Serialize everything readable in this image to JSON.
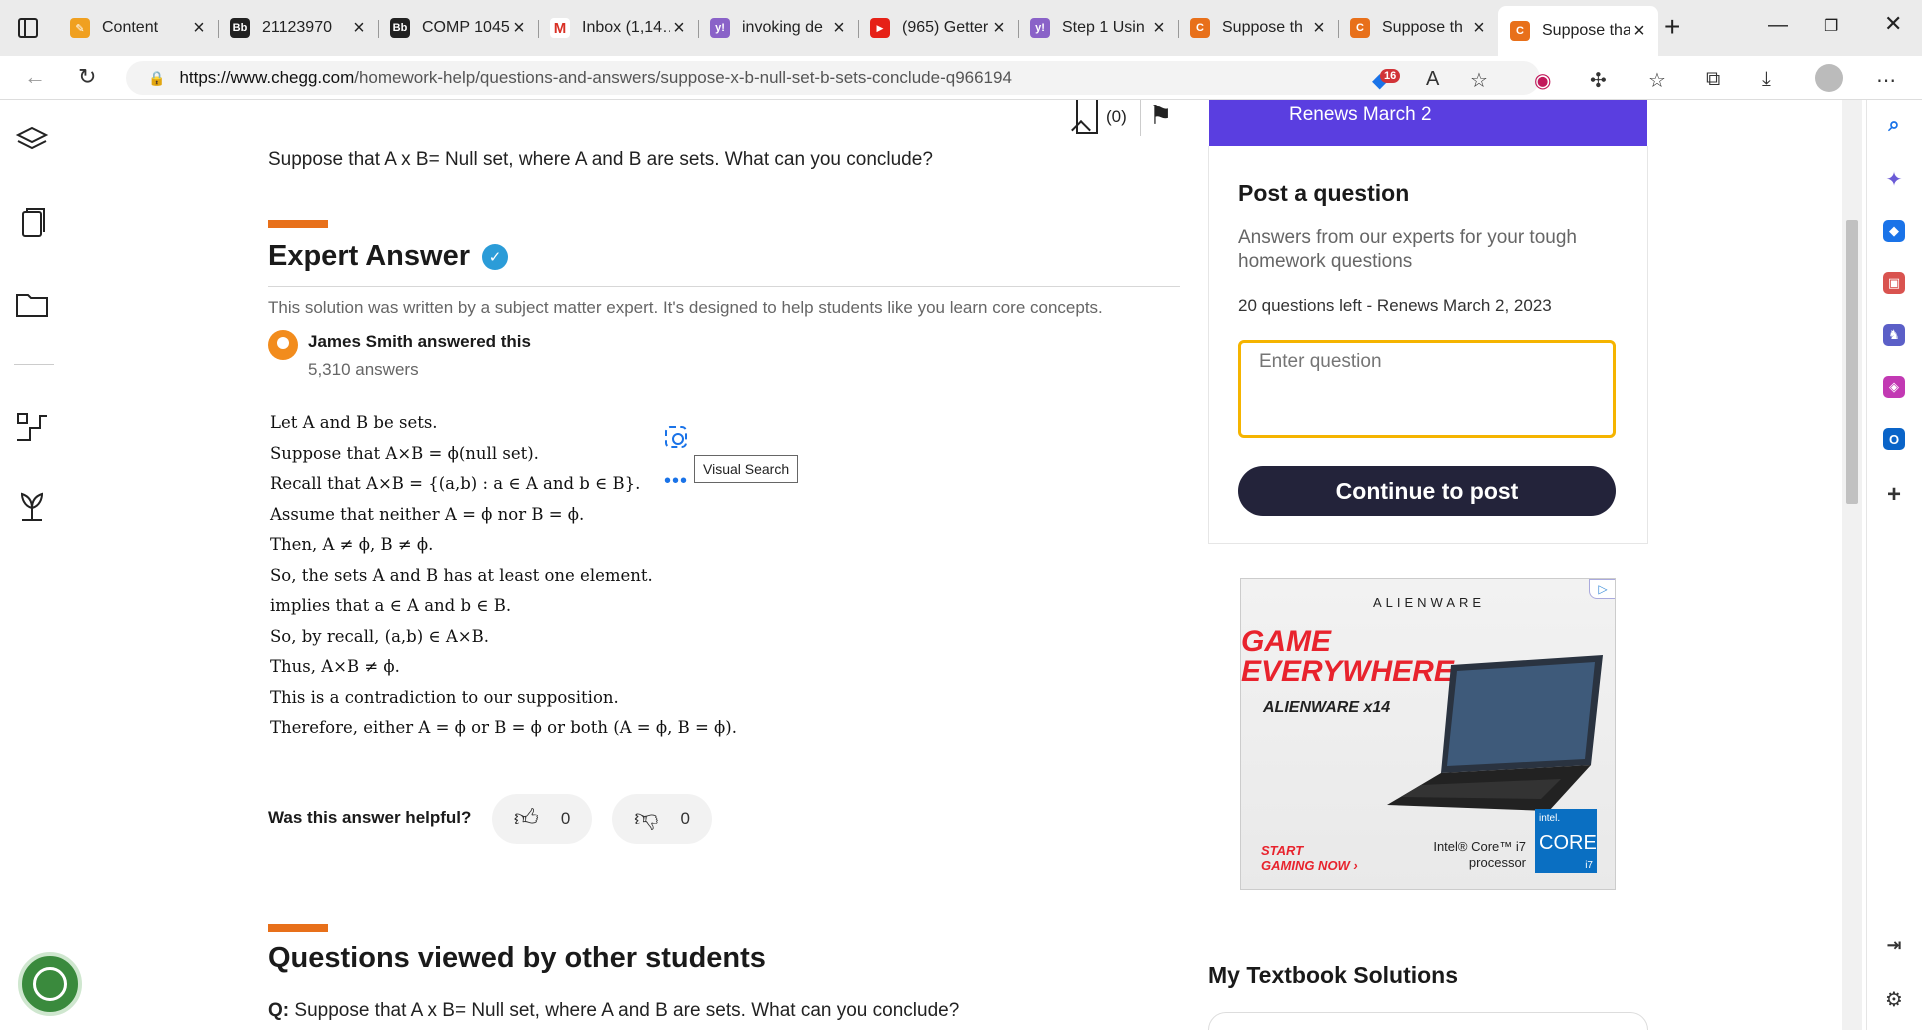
{
  "browser": {
    "tabs": [
      {
        "title": "Content",
        "fav_color": "#f0a020",
        "fav_text": "✎"
      },
      {
        "title": "21123970",
        "fav_color": "#222222",
        "fav_text": "Bb"
      },
      {
        "title": "COMP 1045",
        "fav_color": "#222222",
        "fav_text": "Bb"
      },
      {
        "title": "Inbox (1,14…",
        "fav_color": "#ffffff",
        "fav_text": "M"
      },
      {
        "title": "invoking de",
        "fav_color": "#8a62c8",
        "fav_text": "y!"
      },
      {
        "title": "(965) Getter",
        "fav_color": "#e62117",
        "fav_text": "▶"
      },
      {
        "title": "Step 1 Usin",
        "fav_color": "#8a62c8",
        "fav_text": "y!"
      },
      {
        "title": "Suppose th",
        "fav_color": "#e8701a",
        "fav_text": "C"
      },
      {
        "title": "Suppose th",
        "fav_color": "#e8701a",
        "fav_text": "C"
      },
      {
        "title": "Suppose tha",
        "fav_color": "#e8701a",
        "fav_text": "C"
      }
    ],
    "url_host": "https://www.chegg.com",
    "url_path": "/homework-help/questions-and-answers/suppose-x-b-null-set-b-sets-conclude-q966194",
    "ext_badge": "16"
  },
  "question": {
    "text": "Suppose that A x B= Null set, where A and B are sets. What can you conclude?",
    "bookmark_count": "(0)"
  },
  "expert": {
    "heading": "Expert Answer",
    "note": "This solution was written by a subject matter expert. It's designed to help students like you learn core concepts.",
    "answerer": "James Smith answered this",
    "answers": "5,310 answers"
  },
  "solution_lines": [
    "Let A and B be sets.",
    "Suppose that A×B = ϕ(null set).",
    "Recall that A×B = {(a,b) : a ∈ A and b ∈ B}.",
    "Assume that neither A = ϕ nor B = ϕ.",
    "Then, A ≠ ϕ, B ≠ ϕ.",
    "So, the sets A and B has at least one element.",
    "implies that a ∈ A and b ∈ B.",
    "So, by recall, (a,b) ∈ A×B.",
    "Thus, A×B ≠ ϕ.",
    "This is a contradiction to our supposition.",
    "Therefore, either A = ϕ or B = ϕ or both (A = ϕ, B = ϕ)."
  ],
  "visual_search": {
    "tooltip": "Visual Search"
  },
  "feedback": {
    "question": "Was this answer helpful?",
    "up_count": "0",
    "down_count": "0"
  },
  "viewed": {
    "heading": "Questions viewed by other students",
    "q_prefix": "Q:",
    "q_text": "Suppose that A x B= Null set, where A and B are sets. What can you conclude?"
  },
  "sidebar": {
    "renew_banner": "Renews March 2",
    "post_title": "Post a question",
    "post_sub": "Answers from our experts for your tough homework questions",
    "questions_left": "20 questions left - Renews March 2, 2023",
    "input_placeholder": "Enter question",
    "continue_label": "Continue to post",
    "textbook_heading": "My Textbook Solutions"
  },
  "ad": {
    "brand": "ALIENWARE",
    "headline1": "GAME",
    "headline2": "EVERYWHERE",
    "model": "ALIENWARE x14",
    "cta1": "START",
    "cta2": "GAMING NOW ›",
    "intel_line1": "Intel® Core™ i7",
    "intel_line2": "processor",
    "chip_brand": "intel.",
    "chip_name": "CORE",
    "chip_tier": "i7"
  },
  "colors": {
    "accent_orange": "#e8701a",
    "banner_purple": "#5a3ee0",
    "button_dark": "#23233a",
    "input_border": "#f5b400"
  }
}
